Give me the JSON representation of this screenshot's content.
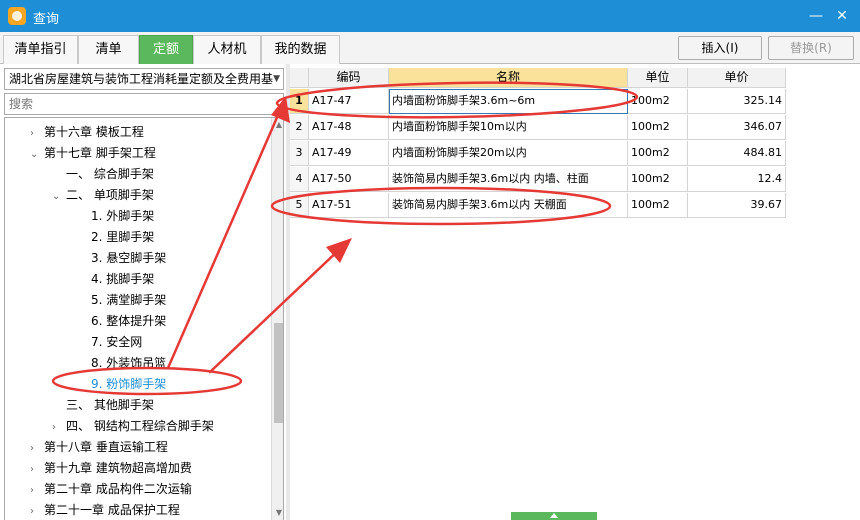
{
  "window": {
    "title": "查询",
    "minimize": "—",
    "close": "✕"
  },
  "tabs": [
    {
      "label": "清单指引"
    },
    {
      "label": "清单"
    },
    {
      "label": "定额"
    },
    {
      "label": "人材机"
    },
    {
      "label": "我的数据"
    }
  ],
  "toolbar": {
    "insert_label": "插入(I)",
    "replace_label": "替换(R)"
  },
  "library": {
    "selected": "湖北省房屋建筑与装饰工程消耗量定额及全费用基"
  },
  "search": {
    "placeholder": "搜索"
  },
  "tree": [
    {
      "label": "第十六章  模板工程",
      "arrow": "›"
    },
    {
      "label": "第十七章  脚手架工程",
      "arrow": "⌄"
    },
    {
      "label": "一、  综合脚手架",
      "arrow": ""
    },
    {
      "label": "二、  单项脚手架",
      "arrow": "⌄"
    },
    {
      "label": "1.  外脚手架",
      "arrow": ""
    },
    {
      "label": "2.  里脚手架",
      "arrow": ""
    },
    {
      "label": "3.  悬空脚手架",
      "arrow": ""
    },
    {
      "label": "4.  挑脚手架",
      "arrow": ""
    },
    {
      "label": "5.  满堂脚手架",
      "arrow": ""
    },
    {
      "label": "6.  整体提升架",
      "arrow": ""
    },
    {
      "label": "7.  安全网",
      "arrow": ""
    },
    {
      "label": "8.  外装饰吊篮",
      "arrow": ""
    },
    {
      "label": "9.  粉饰脚手架",
      "arrow": ""
    },
    {
      "label": "三、  其他脚手架",
      "arrow": ""
    },
    {
      "label": "四、  钢结构工程综合脚手架",
      "arrow": "›"
    },
    {
      "label": "第十八章  垂直运输工程",
      "arrow": "›"
    },
    {
      "label": "第十九章  建筑物超高增加费",
      "arrow": "›"
    },
    {
      "label": "第二十章  成品构件二次运输",
      "arrow": "›"
    },
    {
      "label": "第二十一章  成品保护工程",
      "arrow": "›"
    }
  ],
  "table": {
    "headers": {
      "code": "编码",
      "name": "名称",
      "unit": "单位",
      "price": "单价"
    },
    "rows": [
      {
        "idx": "1",
        "code": "A17-47",
        "name": "内墙面粉饰脚手架3.6m~6m",
        "unit": "100m2",
        "price": "325.14"
      },
      {
        "idx": "2",
        "code": "A17-48",
        "name": "内墙面粉饰脚手架10m以内",
        "unit": "100m2",
        "price": "346.07"
      },
      {
        "idx": "3",
        "code": "A17-49",
        "name": "内墙面粉饰脚手架20m以内",
        "unit": "100m2",
        "price": "484.81"
      },
      {
        "idx": "4",
        "code": "A17-50",
        "name": "装饰简易内脚手架3.6m以内 内墙、柱面",
        "unit": "100m2",
        "price": "12.4"
      },
      {
        "idx": "5",
        "code": "A17-51",
        "name": "装饰简易内脚手架3.6m以内 天棚面",
        "unit": "100m2",
        "price": "39.67"
      }
    ]
  },
  "colors": {
    "titlebar": "#1e8fd6",
    "active_tab": "#5cb85c",
    "annotation": "#e53935",
    "selected_tree": "#1e8fd6"
  }
}
